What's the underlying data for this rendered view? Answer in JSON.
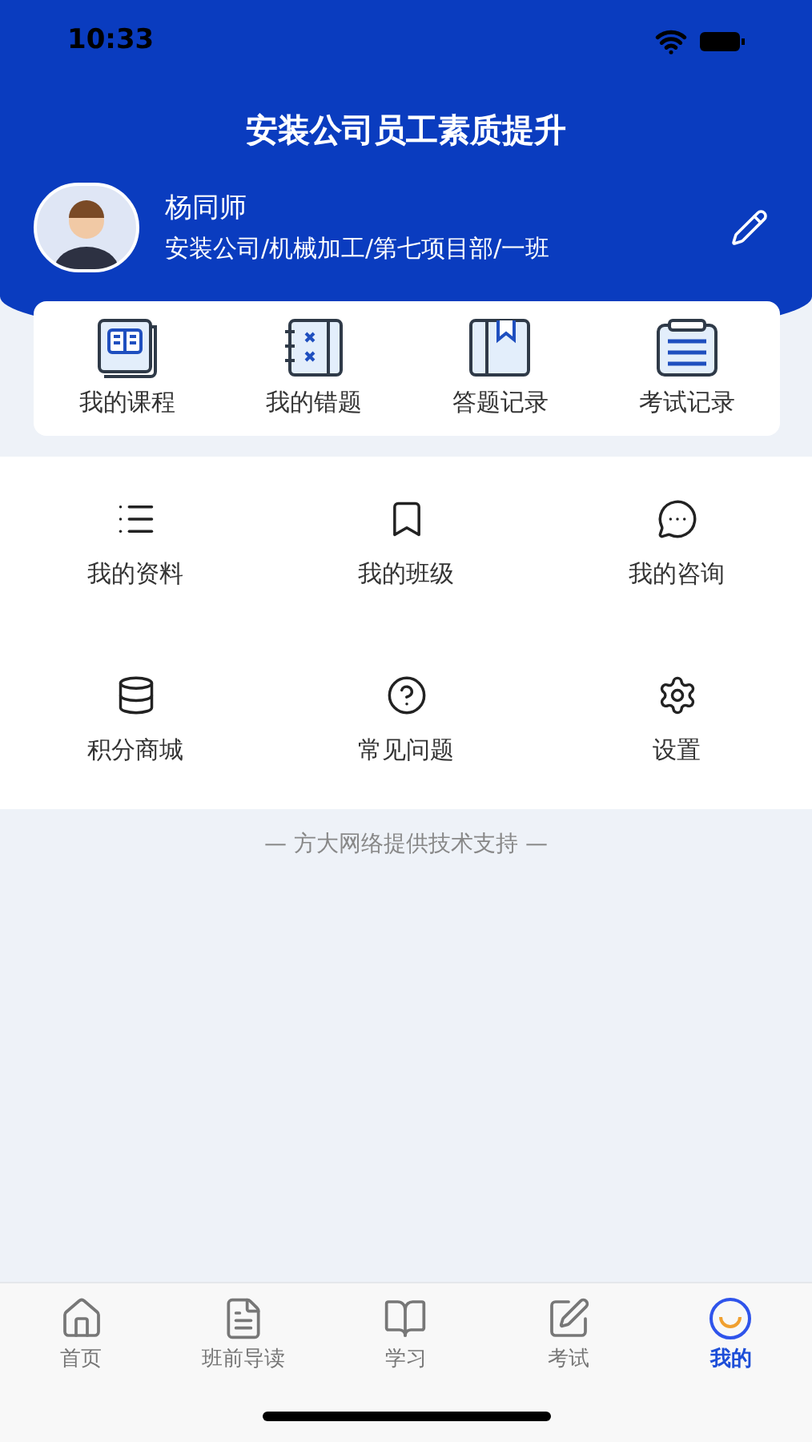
{
  "status_bar": {
    "time": "10:33"
  },
  "header": {
    "title": "安装公司员工素质提升"
  },
  "profile": {
    "name": "杨同师",
    "department": "安装公司/机械加工/第七项目部/一班"
  },
  "quick_links": [
    {
      "label": "我的课程"
    },
    {
      "label": "我的错题"
    },
    {
      "label": "答题记录"
    },
    {
      "label": "考试记录"
    }
  ],
  "menu": [
    {
      "label": "我的资料"
    },
    {
      "label": "我的班级"
    },
    {
      "label": "我的咨询"
    },
    {
      "label": "积分商城"
    },
    {
      "label": "常见问题"
    },
    {
      "label": "设置"
    }
  ],
  "footer": "— 方大网络提供技术支持 —",
  "tab_bar": [
    {
      "label": "首页",
      "selected": false
    },
    {
      "label": "班前导读",
      "selected": false
    },
    {
      "label": "学习",
      "selected": false
    },
    {
      "label": "考试",
      "selected": false
    },
    {
      "label": "我的",
      "selected": true
    }
  ]
}
